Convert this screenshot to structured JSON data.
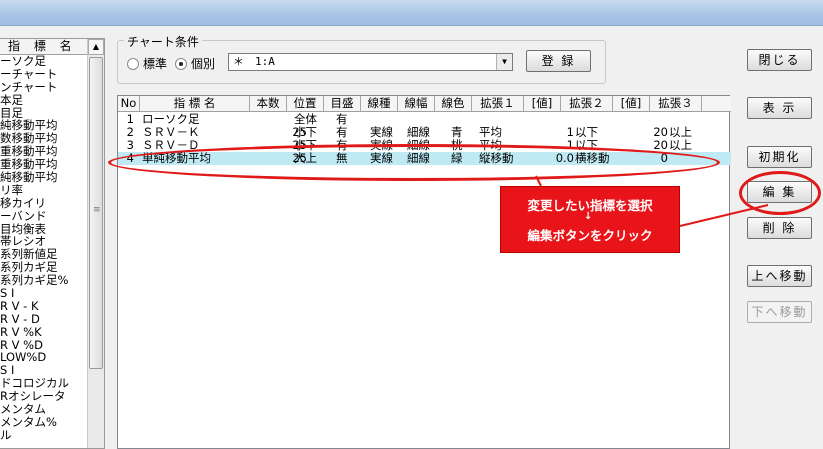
{
  "left_panel": {
    "header": "指 標 名",
    "items": [
      "ーソク足",
      "ーチャート",
      "ンチャート",
      "本足",
      "目足",
      "純移動平均",
      "数移動平均",
      "重移動平均",
      "重移動平均",
      "純移動平均",
      "リ率",
      "移カイリ",
      "ーバンド",
      "目均衡表",
      "帯レシオ",
      "系列新値足",
      "系列カギ足",
      "系列カギ足%",
      "S I",
      "R V - K",
      "R V - D",
      "R V %K",
      "R V %D",
      "LOW%D",
      "S I",
      "ドコロジカル",
      "Rオシレータ",
      "メンタム",
      "メンタム%",
      "ル"
    ]
  },
  "chart_condition": {
    "title": "チャート条件",
    "radio_standard": "標準",
    "radio_individual": "個別",
    "combo_value": "＊　1:A"
  },
  "buttons": {
    "register": "登 録",
    "close": "閉じる",
    "display": "表 示",
    "reset": "初期化",
    "edit": "編 集",
    "delete": "削 除",
    "move_up": "上へ移動",
    "move_down": "下へ移動"
  },
  "grid": {
    "columns": [
      "No",
      "指 標 名",
      "本数",
      "位置",
      "目盛",
      "線種",
      "線幅",
      "線色",
      "拡張１",
      "[値]",
      "拡張２",
      "[値]",
      "拡張３"
    ],
    "rows": [
      {
        "no": "1",
        "name": "ローソク足",
        "count": "",
        "pos": "全体",
        "scale": "有",
        "linetype": "",
        "width": "",
        "color": "",
        "ext1": "",
        "v1": "",
        "ext2": "",
        "v2": "",
        "ext3": ""
      },
      {
        "no": "2",
        "name": "ＳＲＶ－Ｋ",
        "count": "25",
        "pos": "小下",
        "scale": "有",
        "linetype": "実線",
        "width": "細線",
        "color": "青",
        "ext1": "平均",
        "v1": "1",
        "ext2": "以下",
        "v2": "20",
        "ext3": "以上"
      },
      {
        "no": "3",
        "name": "ＳＲＶ－Ｄ",
        "count": "25",
        "pos": "小下",
        "scale": "有",
        "linetype": "実線",
        "width": "細線",
        "color": "桃",
        "ext1": "平均",
        "v1": "1",
        "ext2": "以下",
        "v2": "20",
        "ext3": "以上"
      },
      {
        "no": "4",
        "name": "単純移動平均",
        "count": "25",
        "pos": "大上",
        "scale": "無",
        "linetype": "実線",
        "width": "細線",
        "color": "緑",
        "ext1": "縦移動",
        "v1": "0.0",
        "ext2": "横移動",
        "v2": "0",
        "ext3": ""
      }
    ]
  },
  "callout": {
    "line1": "変更したい指標を選択",
    "arrow": "↓",
    "line2": "編集ボタンをクリック"
  },
  "colors": {
    "annotation_red": "#e01919",
    "selected_row": "#bfeaf4"
  }
}
